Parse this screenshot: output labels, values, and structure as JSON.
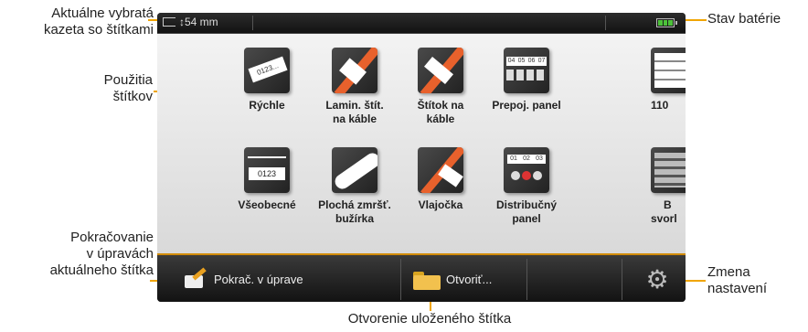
{
  "callouts": {
    "cartridge": [
      "Aktuálne vybratá",
      "kazeta so štítkami"
    ],
    "battery": "Stav batérie",
    "usages": [
      "Použitia",
      "štítkov"
    ],
    "continue": [
      "Pokračovanie",
      "v úpravách",
      "aktuálneho štítka"
    ],
    "settings": [
      "Zmena",
      "nastavení"
    ],
    "open": "Otvorenie uloženého štítka"
  },
  "status": {
    "cartridge": "54 mm"
  },
  "tiles": [
    {
      "label": "Rýchle",
      "label2": "",
      "icon": "quick-label-icon"
    },
    {
      "label": "Lamin. štít.",
      "label2": "na káble",
      "icon": "laminated-cable-icon"
    },
    {
      "label": "Štítok na",
      "label2": "káble",
      "icon": "cable-wrap-icon"
    },
    {
      "label": "Prepoj. panel",
      "label2": "",
      "icon": "patch-panel-icon"
    },
    {
      "label": "110",
      "label2": "",
      "icon": "block-110-icon"
    },
    {
      "label": "Všeobecné",
      "label2": "",
      "icon": "general-icon"
    },
    {
      "label": "Plochá zmršť.",
      "label2": "bužírka",
      "icon": "heat-shrink-icon"
    },
    {
      "label": "Vlajočka",
      "label2": "",
      "icon": "flag-icon"
    },
    {
      "label": "Distribučný",
      "label2": "panel",
      "icon": "distribution-panel-icon"
    },
    {
      "label": "B",
      "label2": "svorl",
      "icon": "terminal-block-icon"
    }
  ],
  "icon_text": {
    "quick": "0123...",
    "general": "0123",
    "patch": [
      "04",
      "05",
      "06",
      "07"
    ],
    "dist": [
      "01",
      "02",
      "03"
    ]
  },
  "bottom": {
    "continue": "Pokrač. v úprave",
    "open": "Otvoriť...",
    "settings_icon": "gear-icon"
  },
  "colors": {
    "accent": "#f0a500",
    "battery": "#4dc23a"
  }
}
